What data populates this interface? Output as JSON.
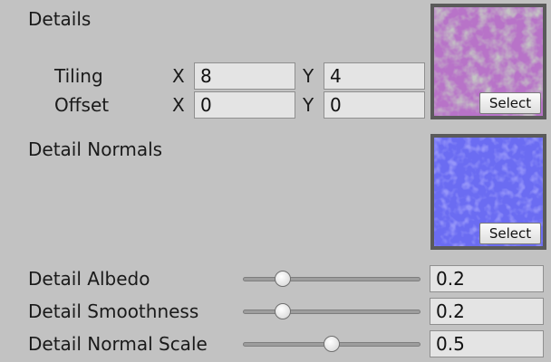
{
  "details": {
    "title": "Details",
    "tiling_label": "Tiling",
    "offset_label": "Offset",
    "tiling": {
      "x_label": "X",
      "x": "8",
      "y_label": "Y",
      "y": "4"
    },
    "offset": {
      "x_label": "X",
      "x": "0",
      "y_label": "Y",
      "y": "0"
    },
    "select_label": "Select",
    "thumbnail_icon": "pink-detail-texture-thumbnail"
  },
  "detail_normals": {
    "title": "Detail Normals",
    "select_label": "Select",
    "thumbnail_icon": "blue-normal-map-thumbnail"
  },
  "sliders": [
    {
      "label": "Detail Albedo",
      "value": "0.2",
      "fraction": 0.2
    },
    {
      "label": "Detail Smoothness",
      "value": "0.2",
      "fraction": 0.2
    },
    {
      "label": "Detail Normal Scale",
      "value": "0.5",
      "fraction": 0.5
    }
  ],
  "colors": {
    "panel_bg": "#c2c2c2",
    "field_bg": "#e4e4e4",
    "albedo_thumb": "#b873c8",
    "normal_thumb": "#6b6cf2"
  }
}
